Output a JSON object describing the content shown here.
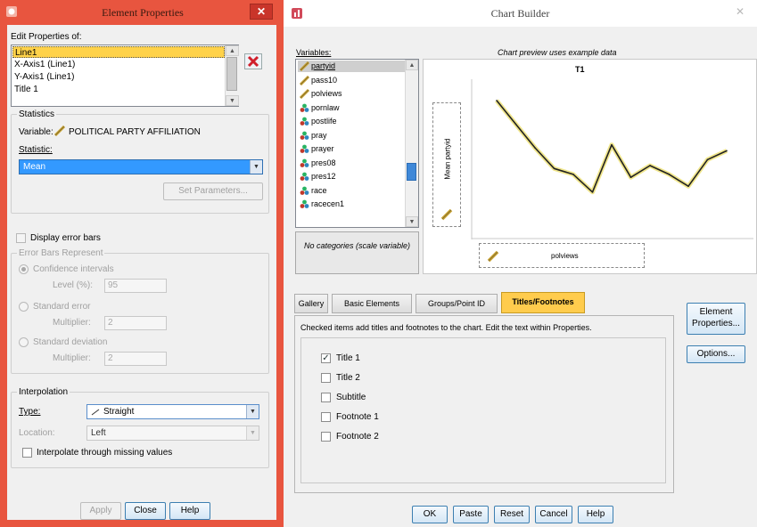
{
  "element_properties": {
    "title": "Element Properties",
    "edit_label": "Edit Properties of:",
    "elements": [
      "Line1",
      "X-Axis1 (Line1)",
      "Y-Axis1 (Line1)",
      "Title 1"
    ],
    "statistics_title": "Statistics",
    "variable_label": "Variable:",
    "variable_value": "POLITICAL PARTY AFFILIATION",
    "statistic_label": "Statistic:",
    "statistic_value": "Mean",
    "set_parameters": "Set Parameters...",
    "display_error_bars": "Display error bars",
    "error_bars_title": "Error Bars Represent",
    "confidence_intervals": "Confidence intervals",
    "level_label": "Level (%):",
    "level_value": "95",
    "standard_error": "Standard error",
    "multiplier_label": "Multiplier:",
    "se_multiplier": "2",
    "standard_deviation": "Standard deviation",
    "sd_multiplier": "2",
    "interpolation_title": "Interpolation",
    "type_label": "Type:",
    "type_value": "Straight",
    "location_label": "Location:",
    "location_value": "Left",
    "interpolate_missing": "Interpolate through missing values",
    "apply": "Apply",
    "close": "Close",
    "help": "Help"
  },
  "chart_builder": {
    "title": "Chart Builder",
    "variables_label": "Variables:",
    "preview_note": "Chart preview uses example data",
    "variables": [
      {
        "name": "partyid",
        "kind": "scale"
      },
      {
        "name": "pass10",
        "kind": "scale"
      },
      {
        "name": "polviews",
        "kind": "scale"
      },
      {
        "name": "pornlaw",
        "kind": "nominal"
      },
      {
        "name": "postlife",
        "kind": "nominal"
      },
      {
        "name": "pray",
        "kind": "nominal"
      },
      {
        "name": "prayer",
        "kind": "nominal"
      },
      {
        "name": "pres08",
        "kind": "nominal"
      },
      {
        "name": "pres12",
        "kind": "nominal"
      },
      {
        "name": "race",
        "kind": "nominal"
      },
      {
        "name": "racecen1",
        "kind": "nominal"
      }
    ],
    "no_categories": "No categories (scale variable)",
    "preview_title": "T1",
    "y_axis_label": "Mean partyid",
    "x_axis_label": "polviews",
    "tabs": [
      "Gallery",
      "Basic Elements",
      "Groups/Point ID",
      "Titles/Footnotes"
    ],
    "active_tab": "Titles/Footnotes",
    "instructions": "Checked items add titles and footnotes to the chart. Edit the text within Properties.",
    "options": [
      {
        "label": "Title 1",
        "checked": true
      },
      {
        "label": "Title 2",
        "checked": false
      },
      {
        "label": "Subtitle",
        "checked": false
      },
      {
        "label": "Footnote 1",
        "checked": false
      },
      {
        "label": "Footnote 2",
        "checked": false
      }
    ],
    "element_properties_button": "Element Properties...",
    "options_button": "Options...",
    "ok": "OK",
    "paste": "Paste",
    "reset": "Reset",
    "cancel": "Cancel",
    "help": "Help"
  },
  "chart_data": {
    "type": "line",
    "title": "T1",
    "xlabel": "polviews",
    "ylabel": "Mean partyid",
    "note": "Chart preview uses example data",
    "values": [
      88,
      72,
      56,
      42,
      38,
      26,
      58,
      36,
      44,
      38,
      30,
      48,
      54
    ],
    "ylim": [
      0,
      100
    ],
    "color": "#222222"
  }
}
